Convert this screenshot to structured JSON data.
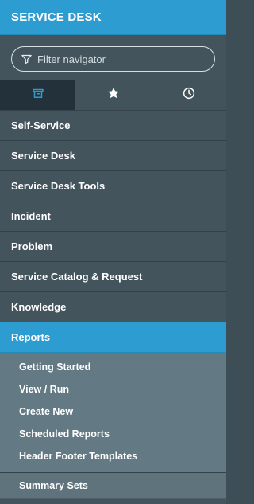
{
  "header": {
    "title": "SERVICE DESK"
  },
  "search": {
    "placeholder": "Filter navigator",
    "icon": "filter-icon"
  },
  "tabs": [
    {
      "icon": "archive-icon",
      "active": true
    },
    {
      "icon": "star-icon",
      "active": false
    },
    {
      "icon": "clock-icon",
      "active": false
    }
  ],
  "nav": {
    "items": [
      {
        "label": "Self-Service"
      },
      {
        "label": "Service Desk"
      },
      {
        "label": "Service Desk Tools"
      },
      {
        "label": "Incident"
      },
      {
        "label": "Problem"
      },
      {
        "label": "Service Catalog & Request"
      },
      {
        "label": "Knowledge"
      },
      {
        "label": "Reports",
        "active": true
      }
    ],
    "reports_children": [
      {
        "label": "Getting Started"
      },
      {
        "label": "View / Run"
      },
      {
        "label": "Create New"
      },
      {
        "label": "Scheduled Reports"
      },
      {
        "label": "Header Footer Templates"
      }
    ],
    "summary_sets": {
      "label": "Summary Sets"
    }
  },
  "colors": {
    "accent": "#2d9cd0",
    "sidebar_bg": "#44545d",
    "active_tab_bg": "#23313a",
    "subnav_bg": "#637983"
  }
}
